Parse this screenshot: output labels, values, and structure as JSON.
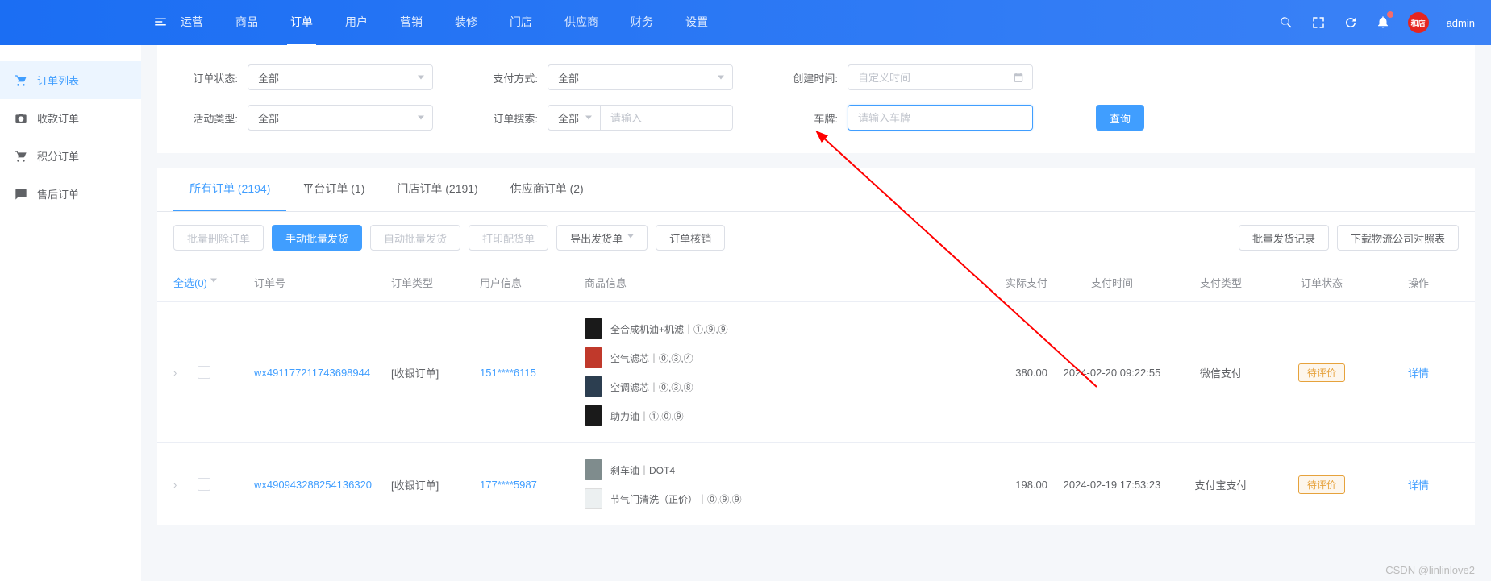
{
  "header": {
    "nav": [
      "运营",
      "商品",
      "订单",
      "用户",
      "营销",
      "装修",
      "门店",
      "供应商",
      "财务",
      "设置"
    ],
    "active_nav": "订单",
    "username": "admin"
  },
  "sidebar": {
    "items": [
      {
        "label": "订单列表",
        "icon": "cart"
      },
      {
        "label": "收款订单",
        "icon": "camera"
      },
      {
        "label": "积分订单",
        "icon": "cart"
      },
      {
        "label": "售后订单",
        "icon": "chat"
      }
    ],
    "active": 0
  },
  "filters": {
    "status_label": "订单状态:",
    "status_value": "全部",
    "pay_label": "支付方式:",
    "pay_value": "全部",
    "create_label": "创建时间:",
    "create_placeholder": "自定义时间",
    "activity_label": "活动类型:",
    "activity_value": "全部",
    "search_label": "订单搜索:",
    "search_scope": "全部",
    "search_placeholder": "请输入",
    "plate_label": "车牌:",
    "plate_placeholder": "请输入车牌",
    "query_btn": "查询"
  },
  "tabs": [
    {
      "label": "所有订单 (2194)"
    },
    {
      "label": "平台订单 (1)"
    },
    {
      "label": "门店订单 (2191)"
    },
    {
      "label": "供应商订单 (2)"
    }
  ],
  "toolbar": {
    "batch_delete": "批量删除订单",
    "manual_ship": "手动批量发货",
    "auto_ship": "自动批量发货",
    "print": "打印配货单",
    "export": "导出发货单",
    "verify": "订单核销",
    "ship_log": "批量发货记录",
    "download": "下载物流公司对照表"
  },
  "columns": {
    "select": "全选(0)",
    "no": "订单号",
    "type": "订单类型",
    "user": "用户信息",
    "goods": "商品信息",
    "pay": "实际支付",
    "time": "支付时间",
    "ptype": "支付类型",
    "status": "订单状态",
    "op": "操作"
  },
  "rows": [
    {
      "no": "wx491177211743698944",
      "type": "[收银订单]",
      "user": "151****6115",
      "goods": [
        {
          "name": "全合成机油+机滤｜①,⑨,⑨",
          "cls": "dark"
        },
        {
          "name": "空气滤芯｜⓪,③,④",
          "cls": "red"
        },
        {
          "name": "空调滤芯｜⓪,③,⑧",
          "cls": "blue"
        },
        {
          "name": "助力油｜①,⓪,⑨",
          "cls": "dark"
        }
      ],
      "pay": "380.00",
      "time": "2024-02-20 09:22:55",
      "ptype": "微信支付",
      "status": "待评价",
      "op": "详情"
    },
    {
      "no": "wx490943288254136320",
      "type": "[收银订单]",
      "user": "177****5987",
      "goods": [
        {
          "name": "刹车油｜DOT4",
          "cls": "gray"
        },
        {
          "name": "节气门清洗（正价）｜⓪,⑨,⑨",
          "cls": "white"
        }
      ],
      "pay": "198.00",
      "time": "2024-02-19 17:53:23",
      "ptype": "支付宝支付",
      "status": "待评价",
      "op": "详情"
    }
  ],
  "watermark": "CSDN @linlinlove2"
}
